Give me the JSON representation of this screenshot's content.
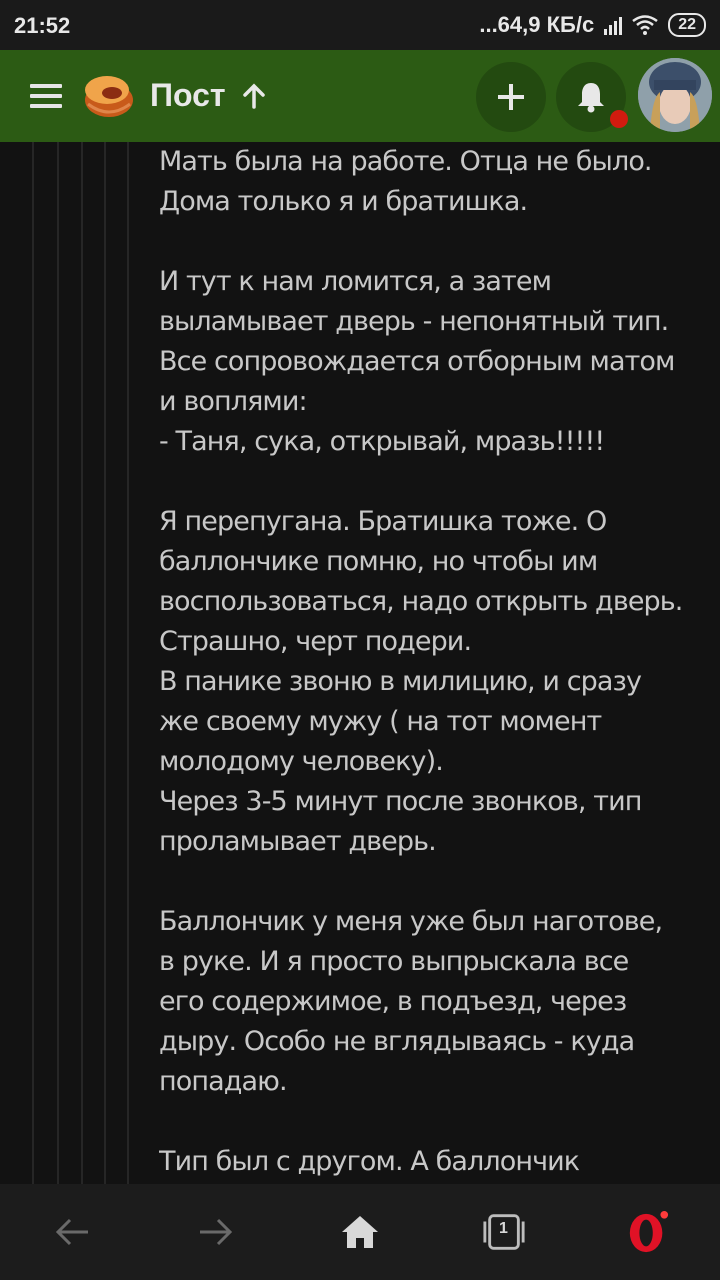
{
  "status_bar": {
    "time": "21:52",
    "network_speed": "...64,9 КБ/с",
    "battery": "22"
  },
  "header": {
    "title": "Пост",
    "accent_color": "#2c5b14",
    "notification_dot_color": "#d11b0f"
  },
  "post": {
    "lines": [
      "Мать была на работе. Отца не было.",
      "Дома только я и братишка.",
      "",
      "И тут к нам ломится, а затем",
      "выламывает дверь - непонятный тип.",
      "Все сопровождается отборным матом",
      "и воплями:",
      "- Таня, сука, открывай, мразь!!!!!",
      "",
      "Я перепугана. Братишка тоже. О",
      "баллончике помню, но чтобы им",
      "воспользоваться, надо открыть дверь.",
      "Страшно, черт подери.",
      "В панике звоню в милицию, и сразу",
      "же своему мужу ( на тот момент",
      "молодому человеку).",
      "Через 3-5 минут после звонков, тип",
      "проламывает дверь.",
      "",
      "Баллончик у меня уже был наготове,",
      "в руке. И я просто выпрыскала все",
      "его содержимое, в подъезд, через",
      "дыру. Особо не вглядываясь - куда",
      "попадаю.",
      "",
      "Тип был с другом. А баллончик"
    ]
  },
  "bottom_nav": {
    "tabs_count": "1"
  }
}
